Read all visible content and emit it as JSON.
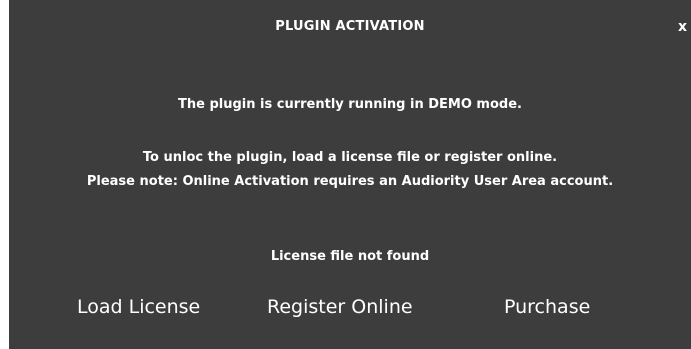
{
  "dialog": {
    "title": "PLUGIN ACTIVATION",
    "close_label": "x",
    "message_demo": "The plugin is currently running in DEMO mode.",
    "message_unlock": "To unloc the plugin, load a license file or register online.",
    "message_note": "Please note: Online Activation requires an Audiority User Area account.",
    "status": "License file not found",
    "buttons": {
      "load_license": "Load License",
      "register_online": "Register Online",
      "purchase": "Purchase"
    }
  },
  "colors": {
    "background": "#3d3d3d",
    "text": "#ffffff"
  }
}
